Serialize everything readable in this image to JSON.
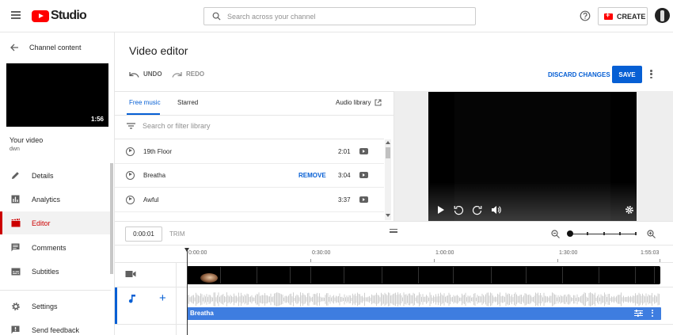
{
  "header": {
    "logo_text": "Studio",
    "search_placeholder": "Search across your channel",
    "create_label": "CREATE"
  },
  "sidebar": {
    "back_label": "Channel content",
    "thumbnail_duration": "1:56",
    "video_label": "Your video",
    "video_sub": "dwn",
    "items": [
      {
        "label": "Details",
        "icon": "pencil-icon"
      },
      {
        "label": "Analytics",
        "icon": "bar-chart-icon"
      },
      {
        "label": "Editor",
        "icon": "clapperboard-icon",
        "active": true
      },
      {
        "label": "Comments",
        "icon": "comment-icon"
      },
      {
        "label": "Subtitles",
        "icon": "subtitles-icon"
      }
    ],
    "footer_items": [
      {
        "label": "Settings",
        "icon": "gear-icon"
      },
      {
        "label": "Send feedback",
        "icon": "feedback-icon"
      }
    ]
  },
  "editor": {
    "title": "Video editor",
    "undo_label": "UNDO",
    "redo_label": "REDO",
    "discard_label": "DISCARD CHANGES",
    "save_label": "SAVE"
  },
  "library": {
    "tabs": [
      "Free music",
      "Starred"
    ],
    "active_tab": "Free music",
    "audio_library_label": "Audio library",
    "filter_placeholder": "Search or filter library",
    "tracks": [
      {
        "name": "19th Floor",
        "duration": "2:01"
      },
      {
        "name": "Breatha",
        "duration": "3:04",
        "action": "REMOVE"
      },
      {
        "name": "Awful",
        "duration": "3:37"
      }
    ]
  },
  "timeline": {
    "current_time": "0:00:01",
    "trim_label": "TRIM",
    "ruler": [
      "0:00:00",
      "0:30:00",
      "1:00:00",
      "1:30:00",
      "1:55:03"
    ],
    "audio_track_label": "Breatha"
  },
  "colors": {
    "accent": "#065fd4",
    "brand_red": "#ff0000",
    "active_red": "#cc0000",
    "audio_bar": "#3e7de0"
  }
}
